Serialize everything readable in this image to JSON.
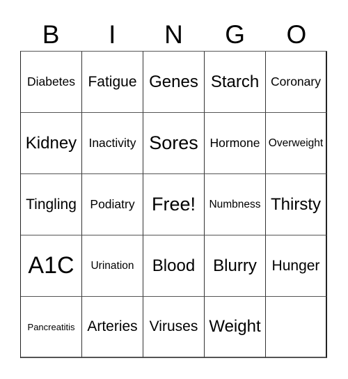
{
  "card": {
    "header": [
      "B",
      "I",
      "N",
      "G",
      "O"
    ],
    "rows": [
      [
        "Diabetes",
        "Fatigue",
        "Genes",
        "Starch",
        "Coronary"
      ],
      [
        "Kidney",
        "Inactivity",
        "Sores",
        "Hormone",
        "Overweight"
      ],
      [
        "Tingling",
        "Podiatry",
        "Free!",
        "Numbness",
        "Thirsty"
      ],
      [
        "A1C",
        "Urination",
        "Blood",
        "Blurry",
        "Hunger"
      ],
      [
        "Pancreatitis",
        "Arteries",
        "Viruses",
        "Weight",
        ""
      ]
    ],
    "free_space_label": "Free!"
  }
}
